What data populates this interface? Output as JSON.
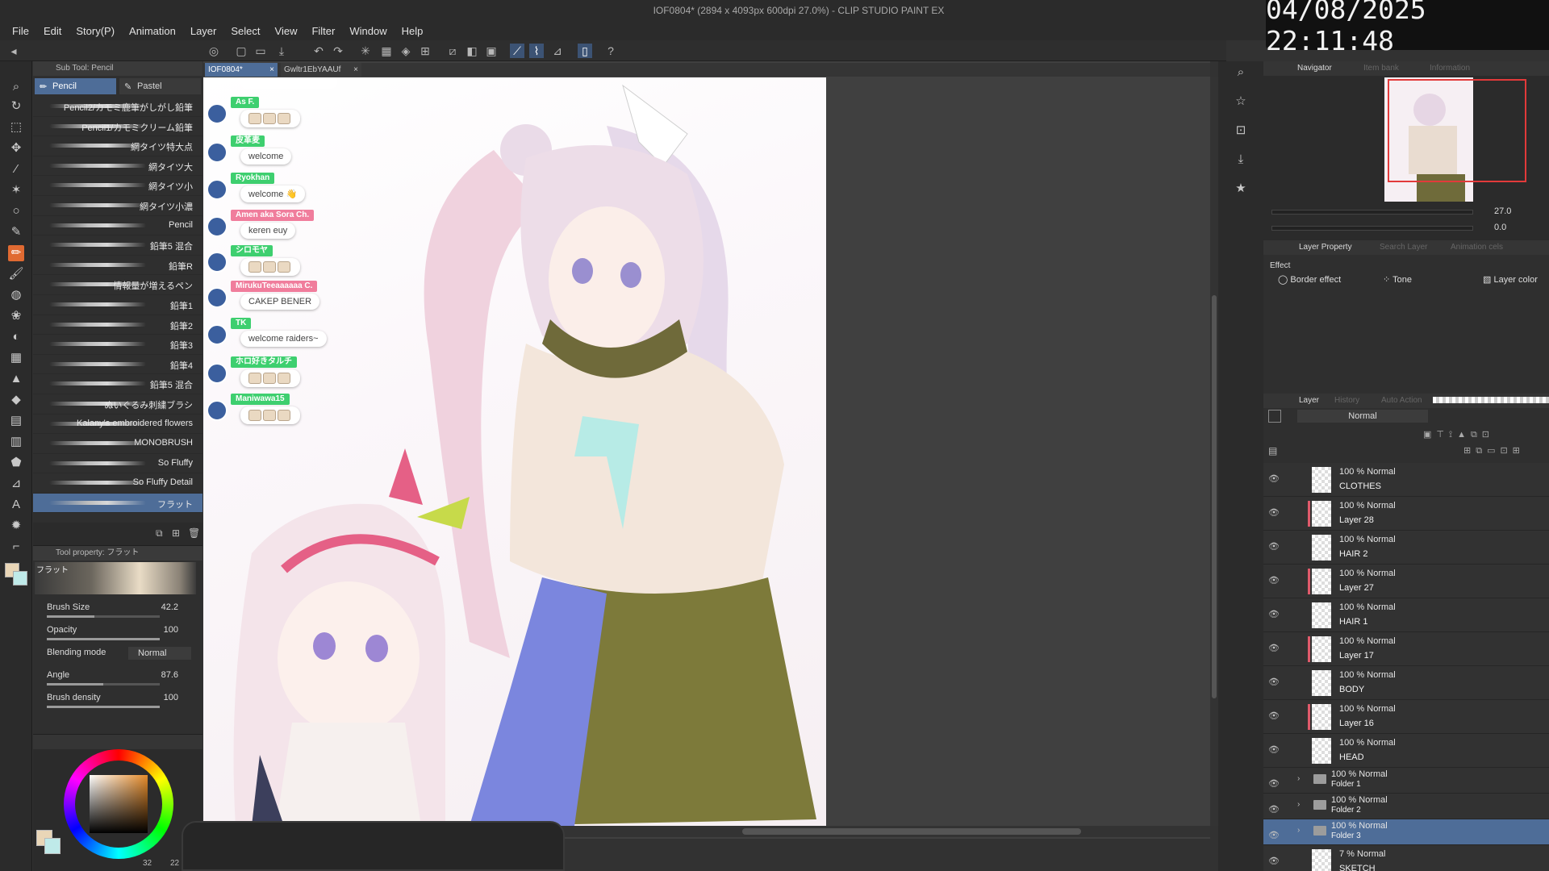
{
  "app": {
    "title": "IOF0804* (2894 x 4093px 600dpi 27.0%) - CLIP STUDIO PAINT EX",
    "clock": "04/08/2025 22:11:48"
  },
  "menu": [
    "File",
    "Edit",
    "Story(P)",
    "Animation",
    "Layer",
    "Select",
    "View",
    "Filter",
    "Window",
    "Help"
  ],
  "subtool": {
    "header": "Sub Tool: Pencil",
    "tabs": [
      {
        "label": "Pencil",
        "active": true
      },
      {
        "label": "Pastel",
        "active": false
      }
    ],
    "brushes": [
      "Pencil2/カモミ鹿筆がしがし鉛筆",
      "Pencil1/カモミクリーム鉛筆",
      "網タイツ特大点",
      "網タイツ大",
      "網タイツ小",
      "網タイツ小濃",
      "Pencil",
      "鉛筆5 混合",
      "鉛筆R",
      "情報量が増えるペン",
      "鉛筆1",
      "鉛筆2",
      "鉛筆3",
      "鉛筆4",
      "鉛筆5 混合",
      "ぬいぐるみ刺繍ブラシ",
      "Kalany's embroidered flowers",
      "MONOBRUSH",
      "So Fluffy",
      "So Fluffy Detail",
      "フラット"
    ],
    "selected_index": 20
  },
  "toolprop": {
    "header": "Tool property: フラット",
    "preset_name": "フラット",
    "rows": [
      {
        "label": "Brush Size",
        "value": "42.2",
        "fill": 0.42
      },
      {
        "label": "Opacity",
        "value": "100",
        "fill": 1.0
      },
      {
        "label": "Blending mode",
        "value": "Normal"
      },
      {
        "label": "Angle",
        "value": "87.6",
        "fill": 0.5
      },
      {
        "label": "Brush density",
        "value": "100",
        "fill": 1.0
      }
    ]
  },
  "color": {
    "status_a": "32",
    "status_b": "22"
  },
  "doc_tabs": [
    {
      "label": "IOF0804*",
      "active": true
    },
    {
      "label": "Gwltr1EbYAAUf",
      "active": false
    }
  ],
  "chat": [
    {
      "name": "As F.",
      "msg": "",
      "name_color": "green"
    },
    {
      "name": "皮革麦",
      "msg": "welcome",
      "name_color": "green"
    },
    {
      "name": "Ryokhan",
      "msg": "welcome 👋",
      "name_color": "green"
    },
    {
      "name": "Amen aka Sora Ch.",
      "msg": "keren euy",
      "name_color": "pink"
    },
    {
      "name": "シロモヤ",
      "msg": "",
      "name_color": "green"
    },
    {
      "name": "MirukuTeeaaaaaa C.",
      "msg": "CAKEP BENER",
      "name_color": "pink"
    },
    {
      "name": "TK",
      "msg": "welcome raiders~",
      "name_color": "green"
    },
    {
      "name": "ホロ好きタルチ",
      "msg": "",
      "name_color": "green"
    },
    {
      "name": "Maniwawa15",
      "msg": "",
      "name_color": "green"
    }
  ],
  "navigator": {
    "tabs": [
      "Navigator",
      "Item bank",
      "Information"
    ],
    "zoom": "27.0",
    "rotation": "0.0"
  },
  "layer_property": {
    "tabs": [
      "Layer Property",
      "Search Layer",
      "Animation cels"
    ],
    "section": "Effect",
    "effects": [
      "Border effect",
      "Tone",
      "Layer color"
    ]
  },
  "layers": {
    "tabs": [
      "Layer",
      "History",
      "Auto Action"
    ],
    "blend_mode": "Normal",
    "items": [
      {
        "blend": "100 % Normal",
        "name": "CLOTHES",
        "folder": false,
        "marked": false
      },
      {
        "blend": "100 % Normal",
        "name": "Layer 28",
        "folder": false,
        "marked": true
      },
      {
        "blend": "100 % Normal",
        "name": "HAIR 2",
        "folder": false,
        "marked": false
      },
      {
        "blend": "100 % Normal",
        "name": "Layer 27",
        "folder": false,
        "marked": true
      },
      {
        "blend": "100 % Normal",
        "name": "HAIR 1",
        "folder": false,
        "marked": false
      },
      {
        "blend": "100 % Normal",
        "name": "Layer 17",
        "folder": false,
        "marked": true
      },
      {
        "blend": "100 % Normal",
        "name": "BODY",
        "folder": false,
        "marked": false
      },
      {
        "blend": "100 % Normal",
        "name": "Layer 16",
        "folder": false,
        "marked": true
      },
      {
        "blend": "100 % Normal",
        "name": "HEAD",
        "folder": false,
        "marked": false
      },
      {
        "blend": "100 % Normal",
        "name": "Folder 1",
        "folder": true,
        "marked": false
      },
      {
        "blend": "100 % Normal",
        "name": "Folder 2",
        "folder": true,
        "marked": false
      },
      {
        "blend": "100 % Normal",
        "name": "Folder 3",
        "folder": true,
        "marked": false,
        "selected": true
      },
      {
        "blend": "7 % Normal",
        "name": "SKETCH",
        "folder": false,
        "marked": false
      }
    ]
  },
  "colors": {
    "accent": "#4e6d98",
    "active_tool": "#e06a32",
    "layer_mark": "#e05a6b"
  }
}
